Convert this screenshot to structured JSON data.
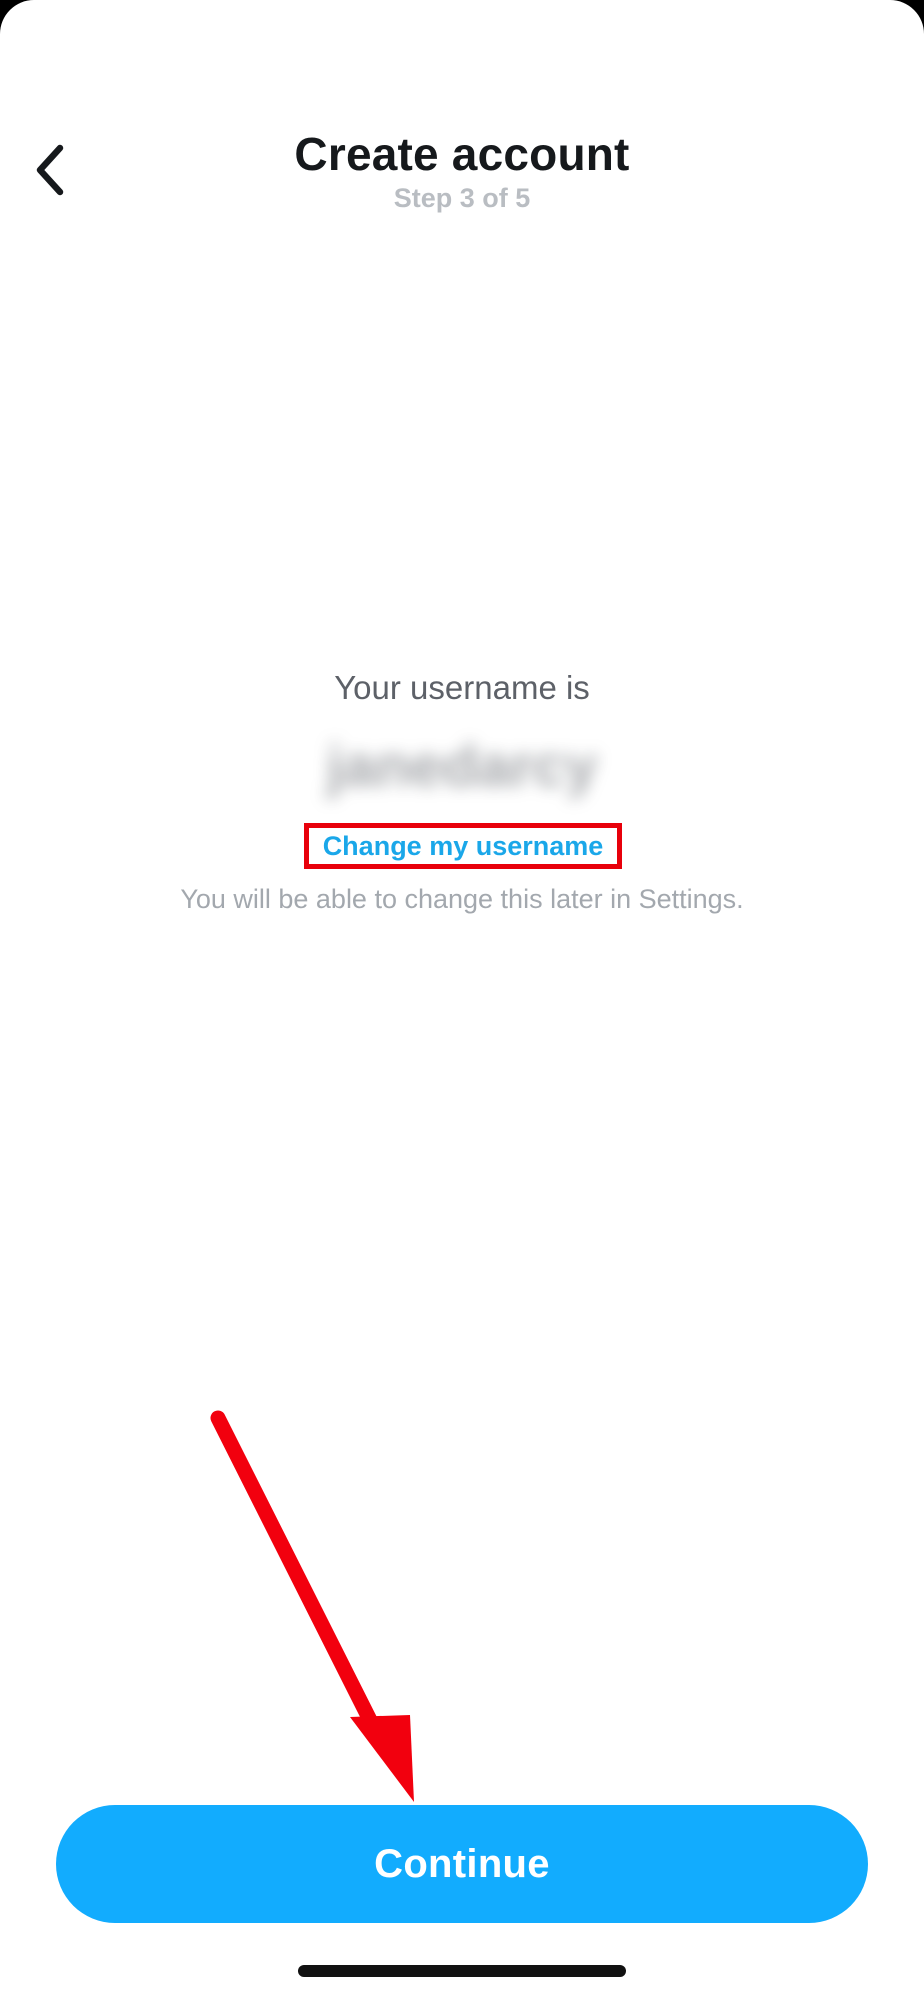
{
  "header": {
    "back_icon": "chevron-left-icon",
    "title": "Create account",
    "subtitle": "Step 3 of 5"
  },
  "main": {
    "caption": "Your username is",
    "username": "janedarcy",
    "username_blurred": true,
    "change_link_label": "Change my username",
    "note": "You will be able to change this later in Settings."
  },
  "footer": {
    "continue_label": "Continue"
  },
  "annotations": {
    "highlight_color": "#e8000b",
    "arrow_color": "#f2000e",
    "arrow_target": "continue-button",
    "highlight_target": "change-username-link"
  },
  "colors": {
    "accent": "#12acfe",
    "link": "#1aa7e9",
    "title": "#16191c",
    "subtitle": "#b9bdc2"
  }
}
